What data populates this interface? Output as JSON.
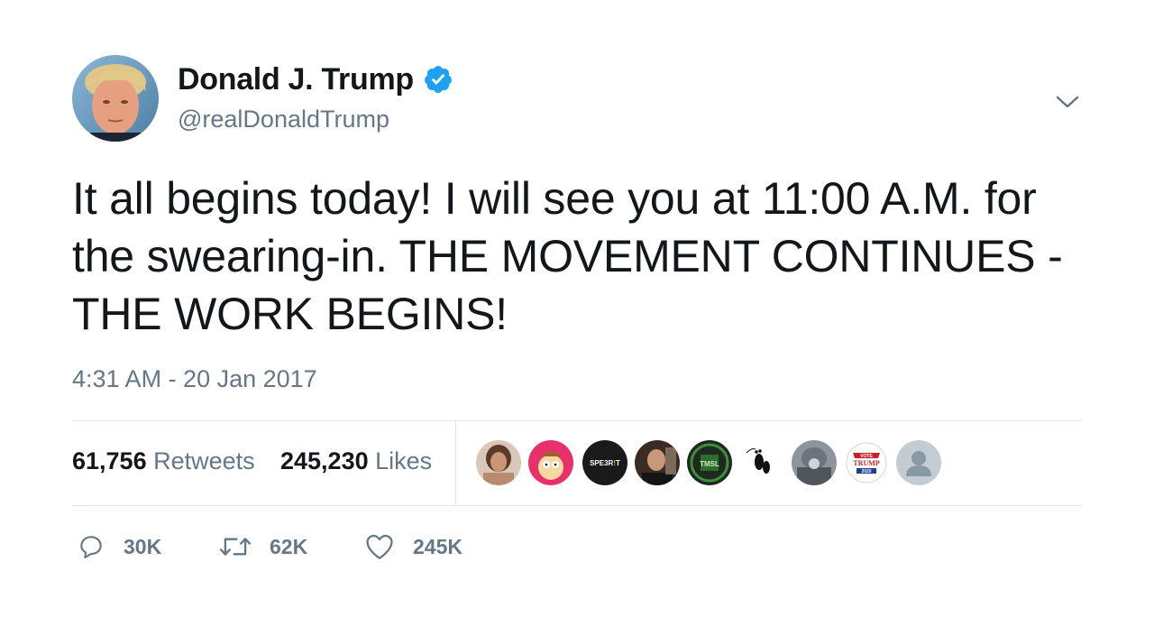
{
  "user": {
    "display_name": "Donald J. Trump",
    "handle": "@realDonaldTrump",
    "verified": true
  },
  "tweet": {
    "text": "It all begins today! I will see you at 11:00 A.M. for the swearing-in. THE MOVEMENT CONTINUES - THE WORK BEGINS!",
    "timestamp": "4:31 AM - 20 Jan 2017"
  },
  "stats": {
    "retweets_count": "61,756",
    "retweets_label": "Retweets",
    "likes_count": "245,230",
    "likes_label": "Likes"
  },
  "likers": [
    {
      "name": "liker-avatar-1",
      "color": "#c9a58c",
      "text": ""
    },
    {
      "name": "liker-avatar-2",
      "color": "#e8316b",
      "text": ""
    },
    {
      "name": "liker-avatar-3",
      "color": "#1a1a1a",
      "text": "SPE3R!T"
    },
    {
      "name": "liker-avatar-4",
      "color": "#3a2c24",
      "text": ""
    },
    {
      "name": "liker-avatar-5",
      "color": "#1f2a1f",
      "text": "TMSL"
    },
    {
      "name": "liker-avatar-6",
      "color": "#ffffff",
      "text": ""
    },
    {
      "name": "liker-avatar-7",
      "color": "#8d949b",
      "text": ""
    },
    {
      "name": "liker-avatar-8",
      "color": "#ffffff",
      "text": "VOTE TRUMP 2020"
    },
    {
      "name": "liker-avatar-9",
      "color": "#c4ccd3",
      "text": ""
    }
  ],
  "actions": {
    "reply_count": "30K",
    "retweet_count": "62K",
    "like_count": "245K"
  },
  "colors": {
    "text": "#14171a",
    "secondary": "#657786",
    "verified": "#1da1f2",
    "divider": "#e1e8ed"
  },
  "icons": {
    "verified": "verified-badge-icon",
    "caret": "chevron-down-icon",
    "reply": "reply-icon",
    "retweet": "retweet-icon",
    "like": "heart-icon"
  }
}
